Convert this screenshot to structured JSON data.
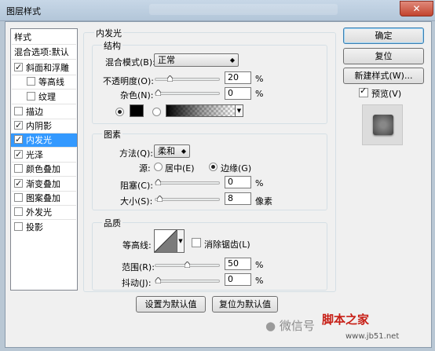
{
  "window": {
    "title": "图层样式",
    "close_glyph": "✕"
  },
  "left_list": {
    "items": [
      {
        "label": "样式",
        "checkbox": false
      },
      {
        "label": "混合选项:默认",
        "checkbox": false
      },
      {
        "label": "斜面和浮雕",
        "checkbox": true,
        "checked": true
      },
      {
        "label": "等高线",
        "checkbox": true,
        "checked": false,
        "indent": true
      },
      {
        "label": "纹理",
        "checkbox": true,
        "checked": false,
        "indent": true
      },
      {
        "label": "描边",
        "checkbox": true,
        "checked": false
      },
      {
        "label": "内阴影",
        "checkbox": true,
        "checked": true
      },
      {
        "label": "内发光",
        "checkbox": true,
        "checked": true,
        "selected": true
      },
      {
        "label": "光泽",
        "checkbox": true,
        "checked": true
      },
      {
        "label": "颜色叠加",
        "checkbox": true,
        "checked": false
      },
      {
        "label": "渐变叠加",
        "checkbox": true,
        "checked": true
      },
      {
        "label": "图案叠加",
        "checkbox": true,
        "checked": false
      },
      {
        "label": "外发光",
        "checkbox": true,
        "checked": false
      },
      {
        "label": "投影",
        "checkbox": true,
        "checked": false
      }
    ]
  },
  "panel": {
    "title": "内发光",
    "structure": {
      "title": "结构",
      "blend_mode_label": "混合模式(B):",
      "blend_mode_value": "正常",
      "opacity_label": "不透明度(O):",
      "opacity_value": "20",
      "opacity_percent": 20,
      "noise_label": "杂色(N):",
      "noise_value": "0",
      "noise_percent": 0,
      "percent_unit": "%"
    },
    "elements": {
      "title": "图素",
      "method_label": "方法(Q):",
      "method_value": "柔和",
      "source_label": "源:",
      "source_center": "居中(E)",
      "source_edge": "边缘(G)",
      "choke_label": "阻塞(C):",
      "choke_value": "0",
      "choke_percent": 0,
      "size_label": "大小(S):",
      "size_value": "8",
      "size_fraction": 0.03,
      "size_unit": "像素",
      "percent_unit": "%"
    },
    "quality": {
      "title": "品质",
      "contour_label": "等高线:",
      "antialias_label": "消除锯齿(L)",
      "range_label": "范围(R):",
      "range_value": "50",
      "range_percent": 50,
      "jitter_label": "抖动(J):",
      "jitter_value": "0",
      "jitter_percent": 0,
      "percent_unit": "%"
    },
    "set_default_label": "设置为默认值",
    "reset_default_label": "复位为默认值"
  },
  "right": {
    "ok_label": "确定",
    "reset_label": "复位",
    "new_style_label": "新建样式(W)...",
    "preview_label": "预览(V)",
    "preview_checked": true
  },
  "watermark": {
    "wechat": "微信号",
    "site_name": "脚本之家",
    "site_url": "www.jb51.net"
  },
  "colors": {
    "selection": "#3399ff",
    "glow_color": "#000000",
    "dialog_bg": "#f0f0f0"
  }
}
